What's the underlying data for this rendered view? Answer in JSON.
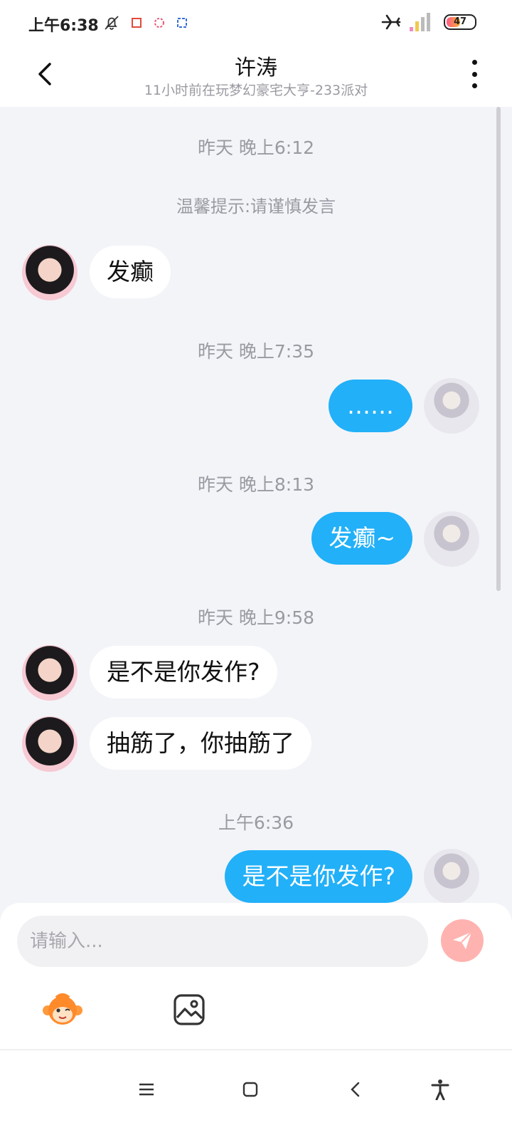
{
  "status_bar": {
    "time": "上午6:38",
    "battery": "47"
  },
  "header": {
    "title": "许涛",
    "subtitle": "11小时前在玩梦幻豪宅大亨-233派对"
  },
  "messages": [
    {
      "type": "time",
      "text": "昨天 晚上6:12"
    },
    {
      "type": "tip",
      "text": "温馨提示:请谨慎发言"
    },
    {
      "type": "in",
      "text": "发癫"
    },
    {
      "type": "time",
      "text": "昨天 晚上7:35"
    },
    {
      "type": "out",
      "text": "……"
    },
    {
      "type": "time",
      "text": "昨天 晚上8:13"
    },
    {
      "type": "out",
      "text": "发癫~"
    },
    {
      "type": "time",
      "text": "昨天 晚上9:58"
    },
    {
      "type": "in",
      "text": "是不是你发作?"
    },
    {
      "type": "in",
      "text": "抽筋了，你抽筋了"
    },
    {
      "type": "time",
      "text": "上午6:36"
    },
    {
      "type": "out",
      "text": "是不是你发作?"
    }
  ],
  "composer": {
    "placeholder": "请输入..."
  },
  "colors": {
    "outgoing_bubble": "#22b0f8",
    "send_button": "#ffb3b0"
  },
  "icons": {
    "back": "chevron-left-icon",
    "more": "more-vertical-icon",
    "send": "paper-plane-icon",
    "emoji": "monkey-emoji-icon",
    "image": "image-icon",
    "nav": [
      "menu-icon",
      "home-square-icon",
      "back-icon",
      "accessibility-icon"
    ]
  }
}
